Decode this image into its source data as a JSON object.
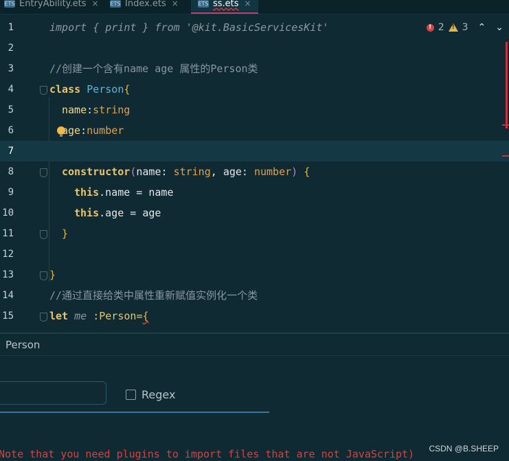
{
  "tabs": [
    {
      "name": "EntryAbility.ets",
      "badge": "ETS",
      "active": false
    },
    {
      "name": "Index.ets",
      "badge": "ETS",
      "active": false
    },
    {
      "name": "ss.ets",
      "badge": "ETS",
      "active": true
    }
  ],
  "inspections": {
    "errors": "2",
    "warnings": "3"
  },
  "code_lines": [
    {
      "n": "1"
    },
    {
      "n": "2"
    },
    {
      "n": "3"
    },
    {
      "n": "4"
    },
    {
      "n": "5"
    },
    {
      "n": "6"
    },
    {
      "n": "7"
    },
    {
      "n": "8"
    },
    {
      "n": "9"
    },
    {
      "n": "10"
    },
    {
      "n": "11"
    },
    {
      "n": "12"
    },
    {
      "n": "13"
    },
    {
      "n": "14"
    },
    {
      "n": "15"
    }
  ],
  "code": {
    "l1_import": "import { print } from '@kit.BasicServicesKit'",
    "l3_comment": "//创建一个含有name age 属性的Person类",
    "l4_kw": "class",
    "l4_type": "Person",
    "l4_brace": "{",
    "l5_prop": "name",
    "l5_colon": ":",
    "l5_type": "string",
    "l6_prop": "age",
    "l6_colon": ":",
    "l6_type": "number",
    "l8_ctor": "constructor",
    "l8_p1": "name",
    "l8_t1": "string",
    "l8_p2": "age",
    "l8_t2": "number",
    "l9_this": "this",
    "l9_rest": ".name = name",
    "l10_this": "this",
    "l10_rest": ".age = age",
    "l11_brace": "}",
    "l13_brace": "}",
    "l14_comment": "//通过直接给类中属性重新赋值实例化一个类",
    "l15_kw": "let",
    "l15_var": "me",
    "l15_colon": ":",
    "l15_type": "Person",
    "l15_eq": "=",
    "l15_brace": "{"
  },
  "panel": {
    "title": "Person",
    "search_value": "",
    "regex_label": "Regex",
    "error_message": "Note that you need plugins to import files that are not JavaScript)"
  },
  "watermark": "CSDN @B.SHEEP",
  "colors": {
    "accent": "#c3407a",
    "error": "#d8413f",
    "keyword": "#e9c46a",
    "type": "#66b2d8"
  }
}
